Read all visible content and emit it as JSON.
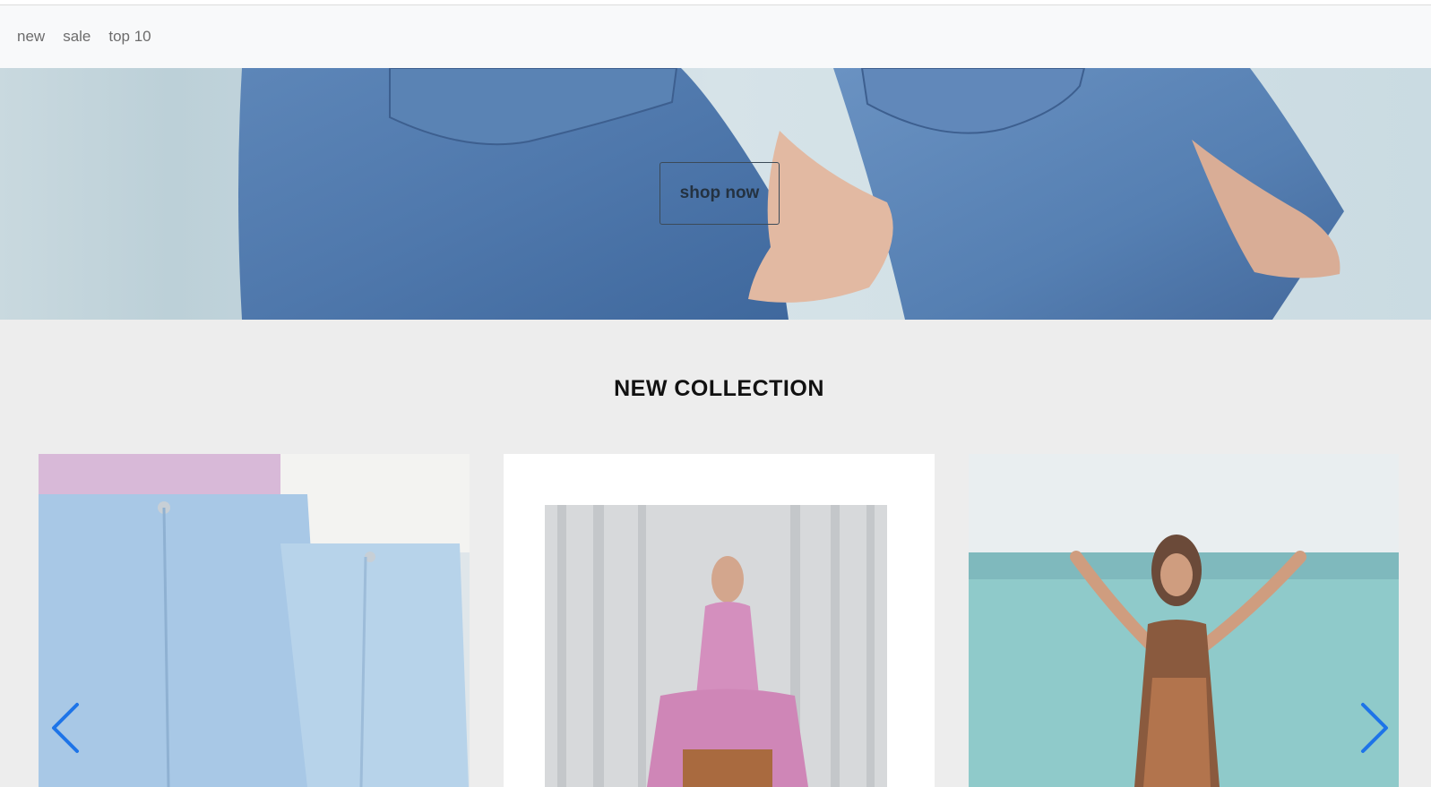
{
  "nav": {
    "links": [
      "new",
      "sale",
      "top 10"
    ]
  },
  "hero": {
    "button_label": "shop now"
  },
  "collection": {
    "title": "NEW COLLECTION"
  },
  "carousel": {
    "prev_icon": "chevron-left-icon",
    "next_icon": "chevron-right-icon",
    "accent_color": "#1e74e8"
  }
}
